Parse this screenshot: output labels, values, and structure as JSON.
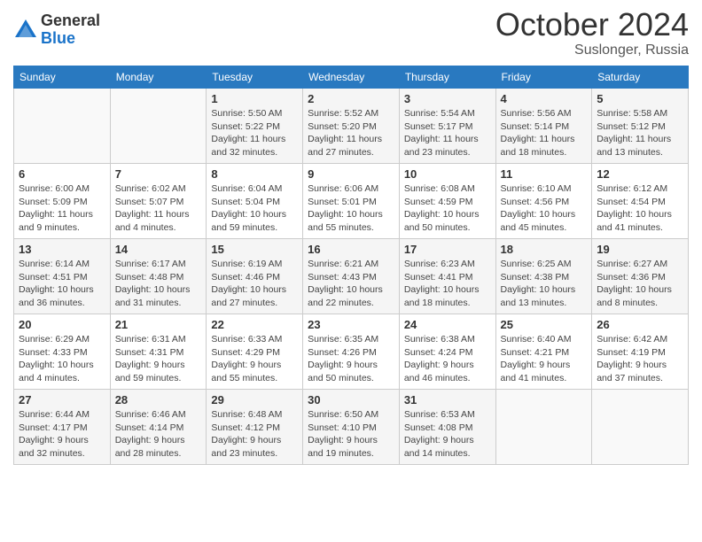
{
  "logo": {
    "general": "General",
    "blue": "Blue"
  },
  "title": "October 2024",
  "subtitle": "Suslonger, Russia",
  "days": [
    "Sunday",
    "Monday",
    "Tuesday",
    "Wednesday",
    "Thursday",
    "Friday",
    "Saturday"
  ],
  "weeks": [
    [
      {
        "num": "",
        "text": ""
      },
      {
        "num": "",
        "text": ""
      },
      {
        "num": "1",
        "text": "Sunrise: 5:50 AM\nSunset: 5:22 PM\nDaylight: 11 hours\nand 32 minutes."
      },
      {
        "num": "2",
        "text": "Sunrise: 5:52 AM\nSunset: 5:20 PM\nDaylight: 11 hours\nand 27 minutes."
      },
      {
        "num": "3",
        "text": "Sunrise: 5:54 AM\nSunset: 5:17 PM\nDaylight: 11 hours\nand 23 minutes."
      },
      {
        "num": "4",
        "text": "Sunrise: 5:56 AM\nSunset: 5:14 PM\nDaylight: 11 hours\nand 18 minutes."
      },
      {
        "num": "5",
        "text": "Sunrise: 5:58 AM\nSunset: 5:12 PM\nDaylight: 11 hours\nand 13 minutes."
      }
    ],
    [
      {
        "num": "6",
        "text": "Sunrise: 6:00 AM\nSunset: 5:09 PM\nDaylight: 11 hours\nand 9 minutes."
      },
      {
        "num": "7",
        "text": "Sunrise: 6:02 AM\nSunset: 5:07 PM\nDaylight: 11 hours\nand 4 minutes."
      },
      {
        "num": "8",
        "text": "Sunrise: 6:04 AM\nSunset: 5:04 PM\nDaylight: 10 hours\nand 59 minutes."
      },
      {
        "num": "9",
        "text": "Sunrise: 6:06 AM\nSunset: 5:01 PM\nDaylight: 10 hours\nand 55 minutes."
      },
      {
        "num": "10",
        "text": "Sunrise: 6:08 AM\nSunset: 4:59 PM\nDaylight: 10 hours\nand 50 minutes."
      },
      {
        "num": "11",
        "text": "Sunrise: 6:10 AM\nSunset: 4:56 PM\nDaylight: 10 hours\nand 45 minutes."
      },
      {
        "num": "12",
        "text": "Sunrise: 6:12 AM\nSunset: 4:54 PM\nDaylight: 10 hours\nand 41 minutes."
      }
    ],
    [
      {
        "num": "13",
        "text": "Sunrise: 6:14 AM\nSunset: 4:51 PM\nDaylight: 10 hours\nand 36 minutes."
      },
      {
        "num": "14",
        "text": "Sunrise: 6:17 AM\nSunset: 4:48 PM\nDaylight: 10 hours\nand 31 minutes."
      },
      {
        "num": "15",
        "text": "Sunrise: 6:19 AM\nSunset: 4:46 PM\nDaylight: 10 hours\nand 27 minutes."
      },
      {
        "num": "16",
        "text": "Sunrise: 6:21 AM\nSunset: 4:43 PM\nDaylight: 10 hours\nand 22 minutes."
      },
      {
        "num": "17",
        "text": "Sunrise: 6:23 AM\nSunset: 4:41 PM\nDaylight: 10 hours\nand 18 minutes."
      },
      {
        "num": "18",
        "text": "Sunrise: 6:25 AM\nSunset: 4:38 PM\nDaylight: 10 hours\nand 13 minutes."
      },
      {
        "num": "19",
        "text": "Sunrise: 6:27 AM\nSunset: 4:36 PM\nDaylight: 10 hours\nand 8 minutes."
      }
    ],
    [
      {
        "num": "20",
        "text": "Sunrise: 6:29 AM\nSunset: 4:33 PM\nDaylight: 10 hours\nand 4 minutes."
      },
      {
        "num": "21",
        "text": "Sunrise: 6:31 AM\nSunset: 4:31 PM\nDaylight: 9 hours\nand 59 minutes."
      },
      {
        "num": "22",
        "text": "Sunrise: 6:33 AM\nSunset: 4:29 PM\nDaylight: 9 hours\nand 55 minutes."
      },
      {
        "num": "23",
        "text": "Sunrise: 6:35 AM\nSunset: 4:26 PM\nDaylight: 9 hours\nand 50 minutes."
      },
      {
        "num": "24",
        "text": "Sunrise: 6:38 AM\nSunset: 4:24 PM\nDaylight: 9 hours\nand 46 minutes."
      },
      {
        "num": "25",
        "text": "Sunrise: 6:40 AM\nSunset: 4:21 PM\nDaylight: 9 hours\nand 41 minutes."
      },
      {
        "num": "26",
        "text": "Sunrise: 6:42 AM\nSunset: 4:19 PM\nDaylight: 9 hours\nand 37 minutes."
      }
    ],
    [
      {
        "num": "27",
        "text": "Sunrise: 6:44 AM\nSunset: 4:17 PM\nDaylight: 9 hours\nand 32 minutes."
      },
      {
        "num": "28",
        "text": "Sunrise: 6:46 AM\nSunset: 4:14 PM\nDaylight: 9 hours\nand 28 minutes."
      },
      {
        "num": "29",
        "text": "Sunrise: 6:48 AM\nSunset: 4:12 PM\nDaylight: 9 hours\nand 23 minutes."
      },
      {
        "num": "30",
        "text": "Sunrise: 6:50 AM\nSunset: 4:10 PM\nDaylight: 9 hours\nand 19 minutes."
      },
      {
        "num": "31",
        "text": "Sunrise: 6:53 AM\nSunset: 4:08 PM\nDaylight: 9 hours\nand 14 minutes."
      },
      {
        "num": "",
        "text": ""
      },
      {
        "num": "",
        "text": ""
      }
    ]
  ]
}
